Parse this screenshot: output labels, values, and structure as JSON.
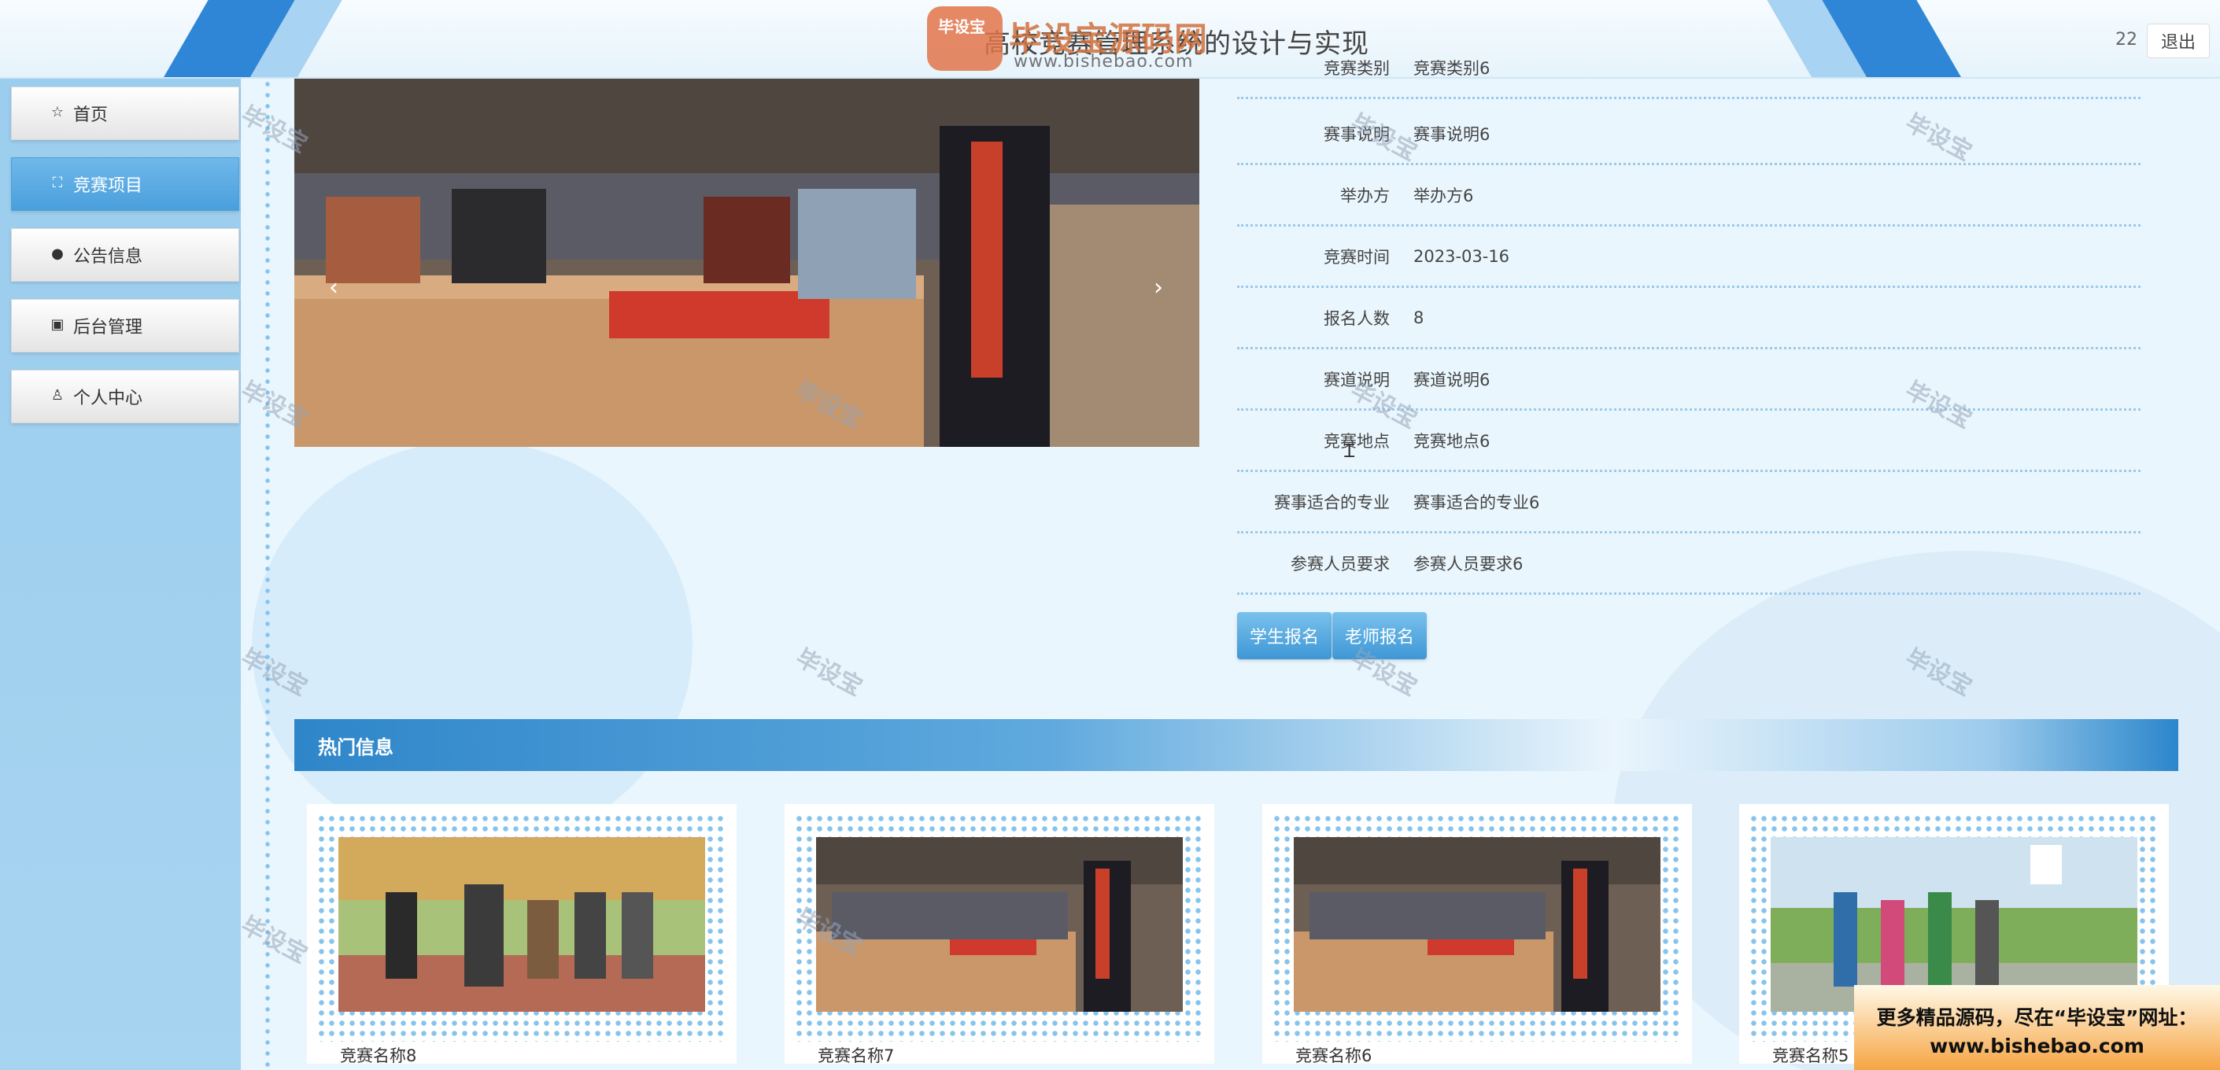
{
  "header": {
    "title": "高校竞赛管理系统的设计与实现",
    "username": "22",
    "logout_label": "退出"
  },
  "logo_watermark": {
    "badge": "毕设宝",
    "name": "毕设宝源码网",
    "url": "www.bishebao.com"
  },
  "sidebar": {
    "items": [
      {
        "label": "首页",
        "icon": "star-icon",
        "active": false
      },
      {
        "label": "竞赛项目",
        "icon": "bag-icon",
        "active": true
      },
      {
        "label": "公告信息",
        "icon": "info-icon",
        "active": false
      },
      {
        "label": "后台管理",
        "icon": "briefcase-icon",
        "active": false
      },
      {
        "label": "个人中心",
        "icon": "user-icon",
        "active": false
      }
    ]
  },
  "carousel": {
    "prev": "‹",
    "next": "›",
    "slide_count": 3,
    "active_slide": 1
  },
  "detail": {
    "rows": [
      {
        "key": "竞赛类别",
        "value": "竞赛类别6"
      },
      {
        "key": "赛事说明",
        "value": "赛事说明6"
      },
      {
        "key": "举办方",
        "value": "举办方6"
      },
      {
        "key": "竞赛时间",
        "value": "2023-03-16"
      },
      {
        "key": "报名人数",
        "value": "8"
      },
      {
        "key": "赛道说明",
        "value": "赛道说明6"
      },
      {
        "key": "竞赛地点",
        "value": "竞赛地点6"
      },
      {
        "key": "赛事适合的专业",
        "value": "赛事适合的专业6"
      },
      {
        "key": "参赛人员要求",
        "value": "参赛人员要求6"
      }
    ],
    "student_signup": "学生报名",
    "teacher_signup": "老师报名"
  },
  "hot": {
    "title": "热门信息",
    "cards": [
      {
        "name": "竞赛名称8"
      },
      {
        "name": "竞赛名称7"
      },
      {
        "name": "竞赛名称6"
      },
      {
        "name": "竞赛名称5"
      }
    ]
  },
  "watermark_text": "毕设宝",
  "ad": {
    "line1": "更多精品源码，尽在“毕设宝”网址：",
    "line2": "www.bishebao.com"
  }
}
